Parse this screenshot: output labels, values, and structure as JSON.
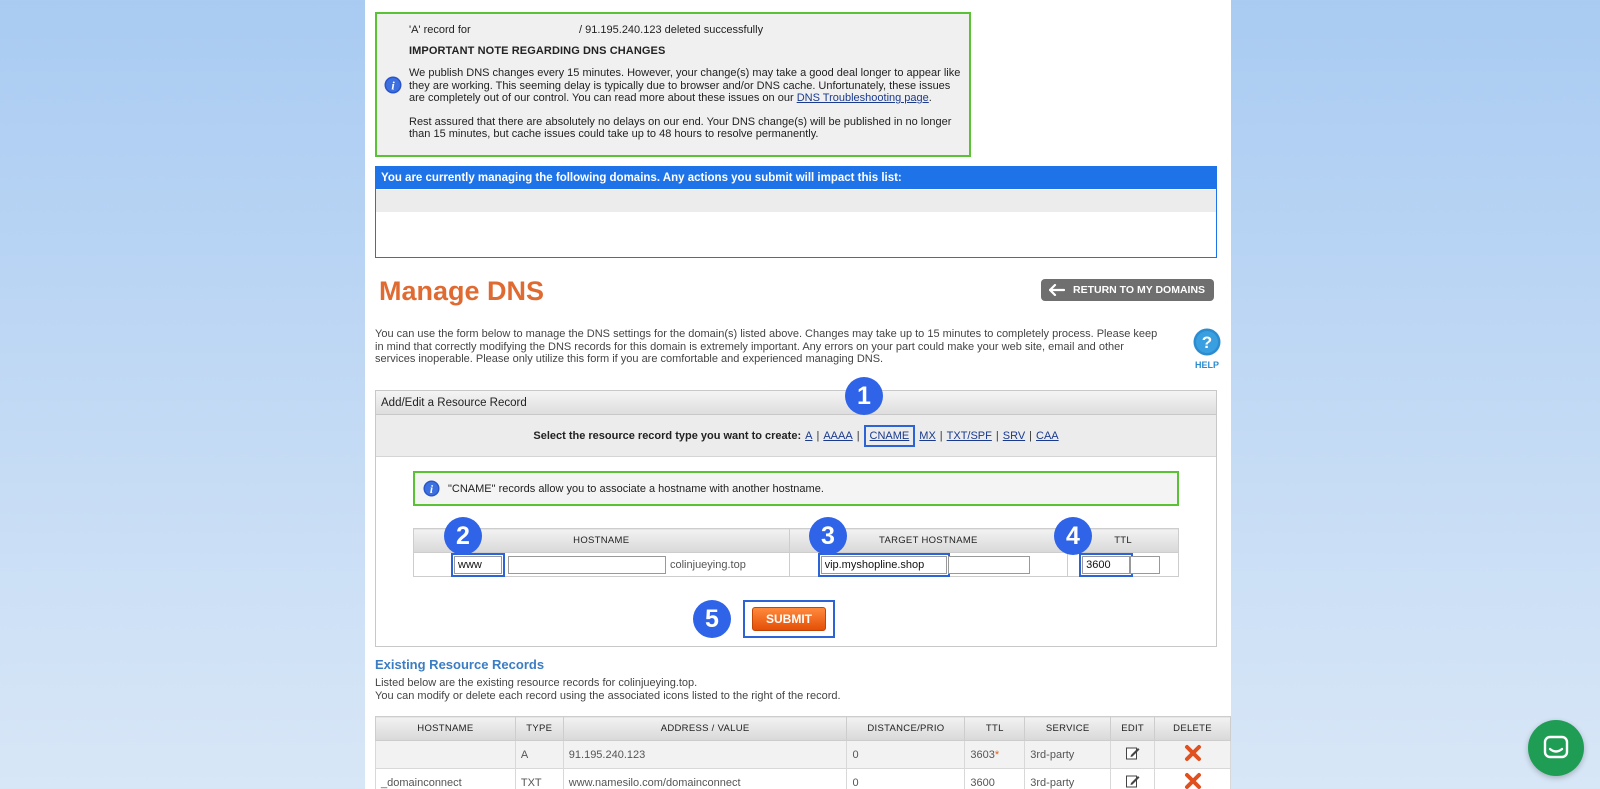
{
  "notice": {
    "deleted_prefix": "'A' record for",
    "deleted_suffix": "/ 91.195.240.123 deleted successfully",
    "heading": "IMPORTANT NOTE REGARDING DNS CHANGES",
    "para1": "We publish DNS changes every 15 minutes. However, your change(s) may take a good deal longer to appear like they are working. This seeming delay is typically due to browser and/or DNS cache. Unfortunately, these issues are completely out of our control. You can read more about these issues on our",
    "para1_link": "DNS Troubleshooting page",
    "para2": "Rest assured that there are absolutely no delays on our end. Your DNS change(s) will be published in no longer than 15 minutes, but cache issues could take up to 48 hours to resolve permanently."
  },
  "managing": {
    "header": "You are currently managing the following domains. Any actions you submit will impact this list:"
  },
  "page": {
    "title": "Manage DNS",
    "return_label": "RETURN TO MY DOMAINS",
    "intro": "You can use the form below to manage the DNS settings for the domain(s) listed above. Changes may take up to 15 minutes to completely process. Please keep in mind that correctly modifying the DNS records for this domain is extremely important. Any errors on your part could make your web site, email and other services inoperable. Please only utilize this form if you are comfortable and experienced managing DNS.",
    "help_label": "HELP"
  },
  "rr": {
    "header": "Add/Edit a Resource Record",
    "select_label": "Select the resource record type you want to create:",
    "types": [
      "A",
      "AAAA",
      "CNAME",
      "MX",
      "TXT/SPF",
      "SRV",
      "CAA"
    ],
    "note": "\"CNAME\" records allow you to associate a hostname with another hostname.",
    "col_hostname": "HOSTNAME",
    "col_target": "TARGET HOSTNAME",
    "col_ttl": "TTL",
    "hostname_value": "www",
    "domain_suffix": "colinjueying.top",
    "target_value": "vip.myshopline.shop",
    "ttl_value": "3600",
    "submit_label": "SUBMIT"
  },
  "badges": [
    "1",
    "2",
    "3",
    "4",
    "5"
  ],
  "existing": {
    "title": "Existing Resource Records",
    "desc1": "Listed below are the existing resource records for colinjueying.top.",
    "desc2": "You can modify or delete each record using the associated icons listed to the right of the record.",
    "columns": [
      "HOSTNAME",
      "TYPE",
      "ADDRESS / VALUE",
      "DISTANCE/PRIO",
      "TTL",
      "SERVICE",
      "EDIT",
      "DELETE"
    ],
    "rows": [
      {
        "hostname": "",
        "type": "A",
        "value": "91.195.240.123",
        "prio": "0",
        "ttl": "3603",
        "ttl_mark": "*",
        "service": "3rd-party"
      },
      {
        "hostname": "_domainconnect",
        "type": "TXT",
        "value": "www.namesilo.com/domainconnect",
        "prio": "0",
        "ttl": "3600",
        "ttl_mark": "",
        "service": "3rd-party"
      }
    ]
  },
  "colors": {
    "accent_blue": "#1e73e8",
    "title_orange": "#e06b32",
    "note_green": "#5bc236",
    "badge_blue": "#2f63e8",
    "chat_green": "#1f9d55"
  }
}
